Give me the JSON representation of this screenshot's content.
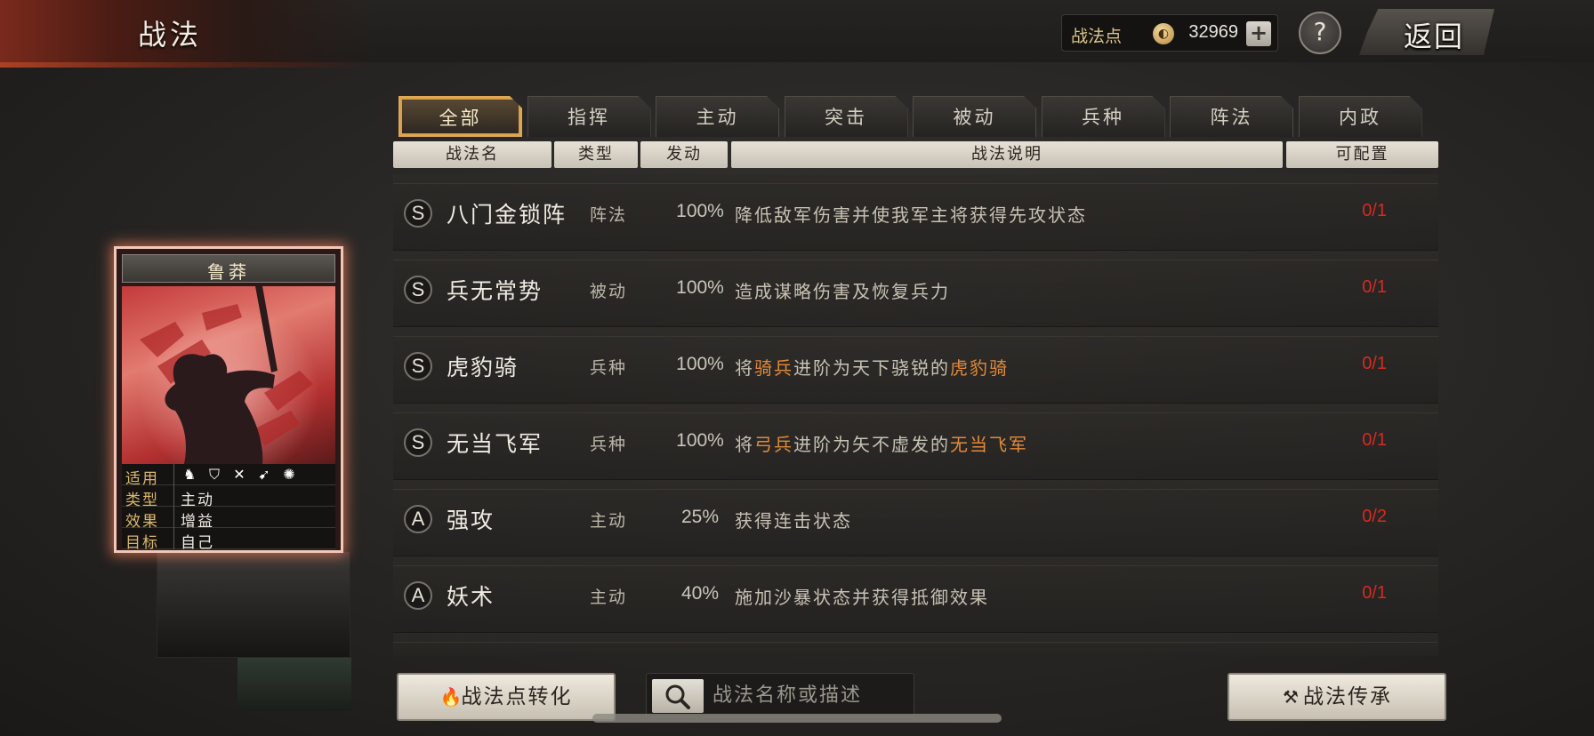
{
  "header": {
    "title": "战法",
    "points_label": "战法点",
    "points_value": "32969",
    "plus": "+",
    "help": "?",
    "back": "返回"
  },
  "tabs": [
    {
      "label": "全部",
      "active": true
    },
    {
      "label": "指挥",
      "active": false
    },
    {
      "label": "主动",
      "active": false
    },
    {
      "label": "突击",
      "active": false
    },
    {
      "label": "被动",
      "active": false
    },
    {
      "label": "兵种",
      "active": false
    },
    {
      "label": "阵法",
      "active": false
    },
    {
      "label": "内政",
      "active": false
    }
  ],
  "columns": {
    "name": "战法名",
    "type": "类型",
    "rate": "发动",
    "desc": "战法说明",
    "config": "可配置"
  },
  "skills": [
    {
      "grade": "S",
      "name": "八门金锁阵",
      "type": "阵法",
      "rate": "100%",
      "desc": [
        {
          "t": "降低敌军伤害并使我军主将获得先攻状态"
        }
      ],
      "config": "0/1"
    },
    {
      "grade": "S",
      "name": "兵无常势",
      "type": "被动",
      "rate": "100%",
      "desc": [
        {
          "t": "造成谋略伤害及恢复兵力"
        }
      ],
      "config": "0/1"
    },
    {
      "grade": "S",
      "name": "虎豹骑",
      "type": "兵种",
      "rate": "100%",
      "desc": [
        {
          "t": "将"
        },
        {
          "t": "骑兵",
          "hl": true
        },
        {
          "t": "进阶为天下骁锐的"
        },
        {
          "t": "虎豹骑",
          "hl": true
        }
      ],
      "config": "0/1"
    },
    {
      "grade": "S",
      "name": "无当飞军",
      "type": "兵种",
      "rate": "100%",
      "desc": [
        {
          "t": "将"
        },
        {
          "t": "弓兵",
          "hl": true
        },
        {
          "t": "进阶为矢不虚发的"
        },
        {
          "t": "无当飞军",
          "hl": true
        }
      ],
      "config": "0/1"
    },
    {
      "grade": "A",
      "name": "强攻",
      "type": "主动",
      "rate": "25%",
      "desc": [
        {
          "t": "获得连击状态"
        }
      ],
      "config": "0/2"
    },
    {
      "grade": "A",
      "name": "妖术",
      "type": "主动",
      "rate": "40%",
      "desc": [
        {
          "t": "施加沙暴状态并获得抵御效果"
        }
      ],
      "config": "0/1"
    }
  ],
  "hero": {
    "name": "鲁莽",
    "stats": {
      "apply_label": "适用",
      "type_label": "类型",
      "type_value": "主动",
      "effect_label": "效果",
      "effect_value": "增益",
      "target_label": "目标",
      "target_value": "自己"
    },
    "unit_icons": [
      "cavalry-icon",
      "shield-icon",
      "bow-icon",
      "spear-icon",
      "wheel-icon"
    ]
  },
  "bottom": {
    "convert_label": "战法点转化",
    "search_placeholder": "战法名称或描述",
    "inherit_label": "战法传承"
  },
  "colors": {
    "highlight": "#e08a3a",
    "config": "#d62a22",
    "active_tab_border": "#e0a850",
    "card_glow": "#e6785a"
  }
}
